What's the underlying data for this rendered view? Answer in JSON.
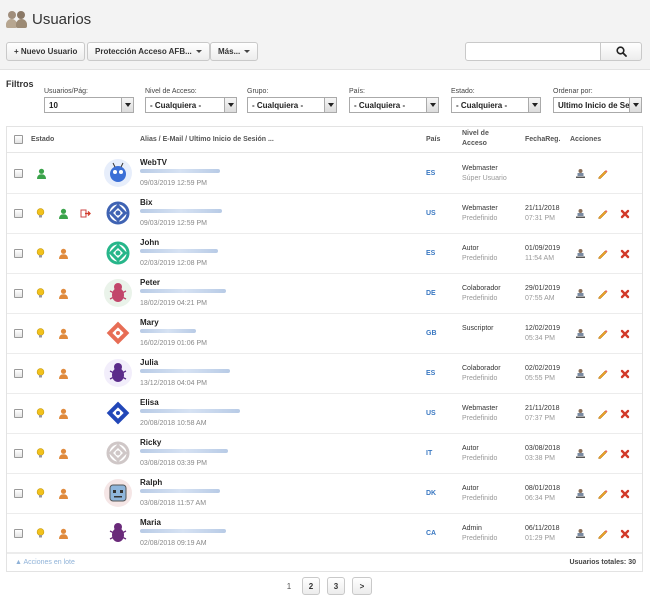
{
  "header": {
    "title": "Usuarios",
    "buttons": {
      "new_user": "+ Nuevo Usuario",
      "protection": "Protección Acceso AFB...",
      "more": "Más..."
    },
    "search": {
      "value": "",
      "placeholder": ""
    }
  },
  "filters": {
    "title": "Filtros",
    "per_page": {
      "label": "Usuarios/Pág:",
      "value": "10"
    },
    "access_level": {
      "label": "Nivel de Acceso:",
      "value": "- Cualquiera -"
    },
    "group": {
      "label": "Grupo:",
      "value": "- Cualquiera -"
    },
    "country": {
      "label": "País:",
      "value": "- Cualquiera -"
    },
    "state": {
      "label": "Estado:",
      "value": "- Cualquiera -"
    },
    "order_by": {
      "label": "Ordenar por:",
      "value": "Ultimo Inicio de Se"
    }
  },
  "table": {
    "headers": {
      "state": "Estado",
      "alias": "Alias / E-Mail / Ultimo Inicio de Sesión ...",
      "country": "País",
      "level_l1": "Nivel de",
      "level_l2": "Acceso",
      "reg_date": "FechaReg.",
      "actions": "Acciones"
    },
    "rows": [
      {
        "name": "WebTV",
        "last_login": "09/03/2019 12:59 PM",
        "country": "ES",
        "level": "Webmaster",
        "level_sub": "Súper Usuario",
        "reg_date": "",
        "reg_time": ""
      },
      {
        "name": "Bix",
        "last_login": "09/03/2019 12:59 PM",
        "country": "US",
        "level": "Webmaster",
        "level_sub": "Predefinido",
        "reg_date": "21/11/2018",
        "reg_time": "07:31 PM"
      },
      {
        "name": "John",
        "last_login": "02/03/2019 12:08 PM",
        "country": "ES",
        "level": "Autor",
        "level_sub": "Predefinido",
        "reg_date": "01/09/2019",
        "reg_time": "11:54 AM"
      },
      {
        "name": "Peter",
        "last_login": "18/02/2019 04:21 PM",
        "country": "DE",
        "level": "Colaborador",
        "level_sub": "Predefinido",
        "reg_date": "29/01/2019",
        "reg_time": "07:55 AM"
      },
      {
        "name": "Mary",
        "last_login": "16/02/2019 01:06 PM",
        "country": "GB",
        "level": "Suscriptor",
        "level_sub": "",
        "reg_date": "12/02/2019",
        "reg_time": "05:34 PM"
      },
      {
        "name": "Julia",
        "last_login": "13/12/2018 04:04 PM",
        "country": "ES",
        "level": "Colaborador",
        "level_sub": "Predefinido",
        "reg_date": "02/02/2019",
        "reg_time": "05:55 PM"
      },
      {
        "name": "Elisa",
        "last_login": "20/08/2018 10:58 AM",
        "country": "US",
        "level": "Webmaster",
        "level_sub": "Predefinido",
        "reg_date": "21/11/2018",
        "reg_time": "07:37 PM"
      },
      {
        "name": "Ricky",
        "last_login": "03/08/2018 03:39 PM",
        "country": "IT",
        "level": "Autor",
        "level_sub": "Predefinido",
        "reg_date": "03/08/2018",
        "reg_time": "03:38 PM"
      },
      {
        "name": "Ralph",
        "last_login": "03/08/2018 11:57 AM",
        "country": "DK",
        "level": "Autor",
        "level_sub": "Predefinido",
        "reg_date": "08/01/2018",
        "reg_time": "06:34 PM"
      },
      {
        "name": "Maria",
        "last_login": "02/08/2018 09:19 AM",
        "country": "CA",
        "level": "Admin",
        "level_sub": "Predefinido",
        "reg_date": "06/11/2018",
        "reg_time": "01:29 PM"
      }
    ],
    "batch_actions": "▲ Acciones en lote",
    "total_users": "Usuarios totales: 30"
  },
  "pagination": {
    "current": "1",
    "page2": "2",
    "page3": "3",
    "next": ">"
  },
  "colors": {
    "link_blue": "#3a78c2",
    "bulb_yellow": "#f2c21b",
    "user_green": "#3aa34a",
    "user_orange": "#e08a3c",
    "delete_red": "#d23a2a",
    "edit_pencil": "#e7a12a"
  }
}
